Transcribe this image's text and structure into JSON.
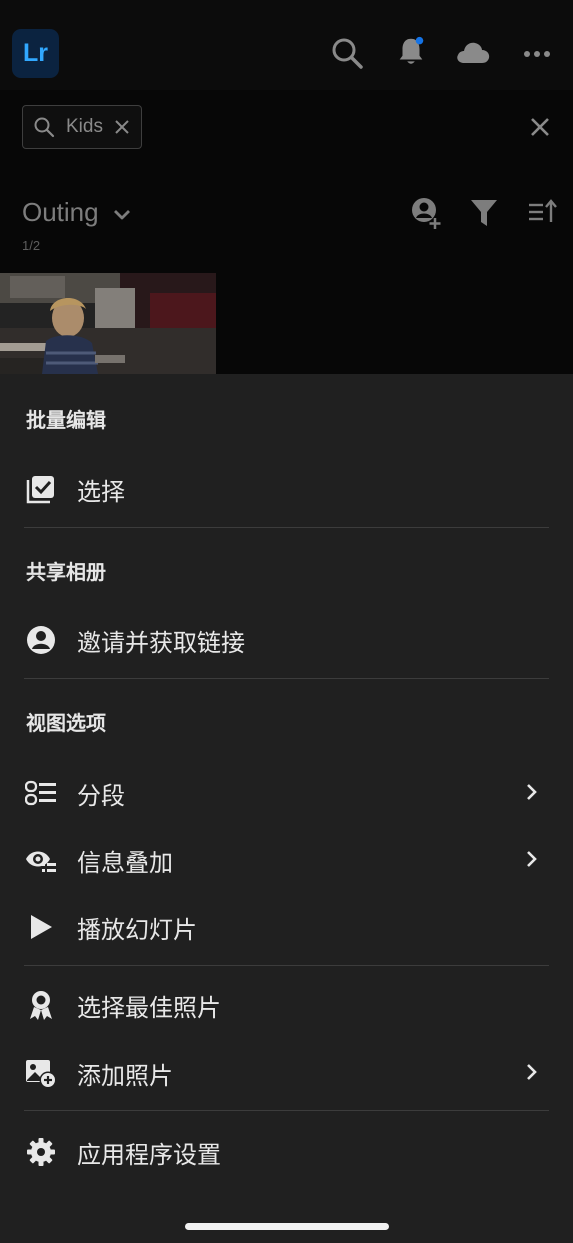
{
  "header": {
    "logo_text": "Lr",
    "notification_dot_color": "#1473e6"
  },
  "search": {
    "query": "Kids"
  },
  "album": {
    "title": "Outing",
    "count": "1/2"
  },
  "sheet": {
    "sections": [
      {
        "heading": "批量编辑",
        "items": [
          {
            "label": "选择",
            "icon": "select-checkbox-icon"
          }
        ]
      },
      {
        "heading": "共享相册",
        "items": [
          {
            "label": "邀请并获取链接",
            "icon": "person-circle-icon"
          }
        ]
      },
      {
        "heading": "视图选项",
        "items": [
          {
            "label": "分段",
            "icon": "segment-icon",
            "has_submenu": true
          },
          {
            "label": "信息叠加",
            "icon": "info-overlay-icon",
            "has_submenu": true
          },
          {
            "label": "播放幻灯片",
            "icon": "play-icon"
          }
        ]
      },
      {
        "heading": "",
        "items": [
          {
            "label": "选择最佳照片",
            "icon": "award-ribbon-icon"
          },
          {
            "label": "添加照片",
            "icon": "add-photo-icon",
            "has_submenu": true
          }
        ]
      },
      {
        "heading": "",
        "items": [
          {
            "label": "应用程序设置",
            "icon": "gear-icon"
          }
        ]
      }
    ]
  }
}
